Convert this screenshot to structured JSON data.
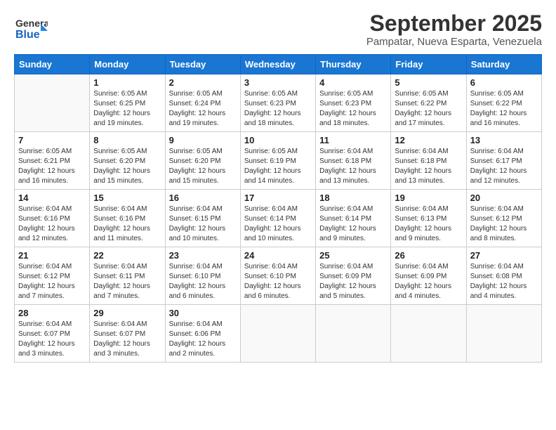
{
  "header": {
    "logo_general": "General",
    "logo_blue": "Blue",
    "title": "September 2025",
    "subtitle": "Pampatar, Nueva Esparta, Venezuela"
  },
  "calendar": {
    "days_of_week": [
      "Sunday",
      "Monday",
      "Tuesday",
      "Wednesday",
      "Thursday",
      "Friday",
      "Saturday"
    ],
    "weeks": [
      [
        {
          "day": "",
          "info": ""
        },
        {
          "day": "1",
          "info": "Sunrise: 6:05 AM\nSunset: 6:25 PM\nDaylight: 12 hours\nand 19 minutes."
        },
        {
          "day": "2",
          "info": "Sunrise: 6:05 AM\nSunset: 6:24 PM\nDaylight: 12 hours\nand 19 minutes."
        },
        {
          "day": "3",
          "info": "Sunrise: 6:05 AM\nSunset: 6:23 PM\nDaylight: 12 hours\nand 18 minutes."
        },
        {
          "day": "4",
          "info": "Sunrise: 6:05 AM\nSunset: 6:23 PM\nDaylight: 12 hours\nand 18 minutes."
        },
        {
          "day": "5",
          "info": "Sunrise: 6:05 AM\nSunset: 6:22 PM\nDaylight: 12 hours\nand 17 minutes."
        },
        {
          "day": "6",
          "info": "Sunrise: 6:05 AM\nSunset: 6:22 PM\nDaylight: 12 hours\nand 16 minutes."
        }
      ],
      [
        {
          "day": "7",
          "info": "Sunrise: 6:05 AM\nSunset: 6:21 PM\nDaylight: 12 hours\nand 16 minutes."
        },
        {
          "day": "8",
          "info": "Sunrise: 6:05 AM\nSunset: 6:20 PM\nDaylight: 12 hours\nand 15 minutes."
        },
        {
          "day": "9",
          "info": "Sunrise: 6:05 AM\nSunset: 6:20 PM\nDaylight: 12 hours\nand 15 minutes."
        },
        {
          "day": "10",
          "info": "Sunrise: 6:05 AM\nSunset: 6:19 PM\nDaylight: 12 hours\nand 14 minutes."
        },
        {
          "day": "11",
          "info": "Sunrise: 6:04 AM\nSunset: 6:18 PM\nDaylight: 12 hours\nand 13 minutes."
        },
        {
          "day": "12",
          "info": "Sunrise: 6:04 AM\nSunset: 6:18 PM\nDaylight: 12 hours\nand 13 minutes."
        },
        {
          "day": "13",
          "info": "Sunrise: 6:04 AM\nSunset: 6:17 PM\nDaylight: 12 hours\nand 12 minutes."
        }
      ],
      [
        {
          "day": "14",
          "info": "Sunrise: 6:04 AM\nSunset: 6:16 PM\nDaylight: 12 hours\nand 12 minutes."
        },
        {
          "day": "15",
          "info": "Sunrise: 6:04 AM\nSunset: 6:16 PM\nDaylight: 12 hours\nand 11 minutes."
        },
        {
          "day": "16",
          "info": "Sunrise: 6:04 AM\nSunset: 6:15 PM\nDaylight: 12 hours\nand 10 minutes."
        },
        {
          "day": "17",
          "info": "Sunrise: 6:04 AM\nSunset: 6:14 PM\nDaylight: 12 hours\nand 10 minutes."
        },
        {
          "day": "18",
          "info": "Sunrise: 6:04 AM\nSunset: 6:14 PM\nDaylight: 12 hours\nand 9 minutes."
        },
        {
          "day": "19",
          "info": "Sunrise: 6:04 AM\nSunset: 6:13 PM\nDaylight: 12 hours\nand 9 minutes."
        },
        {
          "day": "20",
          "info": "Sunrise: 6:04 AM\nSunset: 6:12 PM\nDaylight: 12 hours\nand 8 minutes."
        }
      ],
      [
        {
          "day": "21",
          "info": "Sunrise: 6:04 AM\nSunset: 6:12 PM\nDaylight: 12 hours\nand 7 minutes."
        },
        {
          "day": "22",
          "info": "Sunrise: 6:04 AM\nSunset: 6:11 PM\nDaylight: 12 hours\nand 7 minutes."
        },
        {
          "day": "23",
          "info": "Sunrise: 6:04 AM\nSunset: 6:10 PM\nDaylight: 12 hours\nand 6 minutes."
        },
        {
          "day": "24",
          "info": "Sunrise: 6:04 AM\nSunset: 6:10 PM\nDaylight: 12 hours\nand 6 minutes."
        },
        {
          "day": "25",
          "info": "Sunrise: 6:04 AM\nSunset: 6:09 PM\nDaylight: 12 hours\nand 5 minutes."
        },
        {
          "day": "26",
          "info": "Sunrise: 6:04 AM\nSunset: 6:09 PM\nDaylight: 12 hours\nand 4 minutes."
        },
        {
          "day": "27",
          "info": "Sunrise: 6:04 AM\nSunset: 6:08 PM\nDaylight: 12 hours\nand 4 minutes."
        }
      ],
      [
        {
          "day": "28",
          "info": "Sunrise: 6:04 AM\nSunset: 6:07 PM\nDaylight: 12 hours\nand 3 minutes."
        },
        {
          "day": "29",
          "info": "Sunrise: 6:04 AM\nSunset: 6:07 PM\nDaylight: 12 hours\nand 3 minutes."
        },
        {
          "day": "30",
          "info": "Sunrise: 6:04 AM\nSunset: 6:06 PM\nDaylight: 12 hours\nand 2 minutes."
        },
        {
          "day": "",
          "info": ""
        },
        {
          "day": "",
          "info": ""
        },
        {
          "day": "",
          "info": ""
        },
        {
          "day": "",
          "info": ""
        }
      ]
    ]
  }
}
